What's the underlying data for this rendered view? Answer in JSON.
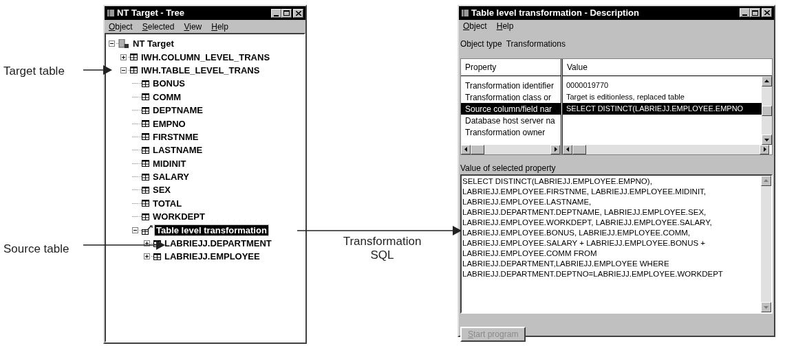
{
  "callouts": {
    "target": "Target table",
    "source": "Source table",
    "sql": "Transformation SQL"
  },
  "tree_window": {
    "title": "NT Target - Tree",
    "menu": [
      "Object",
      "Selected",
      "View",
      "Help"
    ],
    "tree": [
      {
        "label": "NT Target",
        "kind": "server",
        "expanded": true,
        "selected": false,
        "children": [
          {
            "label": "IWH.COLUMN_LEVEL_TRANS",
            "kind": "table",
            "expanded": false,
            "selected": false
          },
          {
            "label": "IWH.TABLE_LEVEL_TRANS",
            "kind": "table",
            "expanded": true,
            "selected": false,
            "children": [
              {
                "label": "BONUS",
                "kind": "column",
                "selected": false
              },
              {
                "label": "COMM",
                "kind": "column",
                "selected": false
              },
              {
                "label": "DEPTNAME",
                "kind": "column",
                "selected": false
              },
              {
                "label": "EMPNO",
                "kind": "column",
                "selected": false
              },
              {
                "label": "FIRSTNME",
                "kind": "column",
                "selected": false
              },
              {
                "label": "LASTNAME",
                "kind": "column",
                "selected": false
              },
              {
                "label": "MIDINIT",
                "kind": "column",
                "selected": false
              },
              {
                "label": "SALARY",
                "kind": "column",
                "selected": false
              },
              {
                "label": "SEX",
                "kind": "column",
                "selected": false
              },
              {
                "label": "TOTAL",
                "kind": "column",
                "selected": false
              },
              {
                "label": "WORKDEPT",
                "kind": "column",
                "selected": false
              },
              {
                "label": "Table level transformation",
                "kind": "transformation",
                "expanded": true,
                "selected": true,
                "children": [
                  {
                    "label": "LABRIEJJ.DEPARTMENT",
                    "kind": "table",
                    "expanded": false,
                    "selected": false
                  },
                  {
                    "label": "LABRIEJJ.EMPLOYEE",
                    "kind": "table",
                    "expanded": false,
                    "selected": false
                  }
                ]
              }
            ]
          }
        ]
      }
    ]
  },
  "description_window": {
    "title": "Table level transformation - Description",
    "menu": [
      "Object",
      "Help"
    ],
    "object_type_label": "Object type",
    "object_type": "Transformations",
    "table": {
      "columns": [
        "Property",
        "Value"
      ],
      "rows": [
        {
          "property": "Transformation identifier",
          "value": "0000019770",
          "selected": false
        },
        {
          "property": "Transformation class or",
          "value": "Target is editionless, replaced table",
          "selected": false
        },
        {
          "property": "Source column/field nar",
          "value": "SELECT DISTINCT(LABRIEJJ.EMPLOYEE.EMPNO",
          "selected": true
        },
        {
          "property": "Database host server na",
          "value": "",
          "selected": false
        },
        {
          "property": "Transformation owner",
          "value": "",
          "selected": false
        }
      ]
    },
    "value_label": "Value of selected property",
    "value_text": [
      "SELECT DISTINCT(LABRIEJJ.EMPLOYEE.EMPNO),",
      "LABRIEJJ.EMPLOYEE.FIRSTNME, LABRIEJJ.EMPLOYEE.MIDINIT,",
      "LABRIEJJ.EMPLOYEE.LASTNAME,",
      "LABRIEJJ.DEPARTMENT.DEPTNAME, LABRIEJJ.EMPLOYEE.SEX,",
      "LABRIEJJ.EMPLOYEE.WORKDEPT, LABRIEJJ.EMPLOYEE.SALARY,",
      "LABRIEJJ.EMPLOYEE.BONUS, LABRIEJJ.EMPLOYEE.COMM,",
      "LABRIEJJ.EMPLOYEE.SALARY + LABRIEJJ.EMPLOYEE.BONUS +",
      "LABRIEJJ.EMPLOYEE.COMM FROM",
      "LABRIEJJ.DEPARTMENT,LABRIEJJ.EMPLOYEE WHERE",
      "LABRIEJJ.DEPARTMENT.DEPTNO=LABRIEJJ.EMPLOYEE.WORKDEPT"
    ],
    "button": {
      "label": "Start program",
      "disabled": true
    }
  }
}
